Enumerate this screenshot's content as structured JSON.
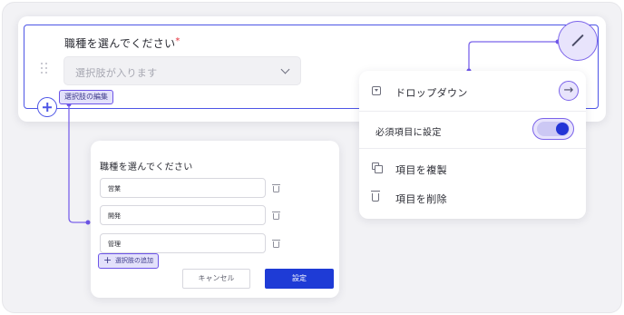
{
  "question": {
    "title": "職種を選んでください",
    "required_mark": "*",
    "select_placeholder": "選択肢が入ります"
  },
  "tags": {
    "edit_options": "選択肢の編集",
    "add_option": "選択肢の追加"
  },
  "menu": {
    "dropdown_label": "ドロップダウン",
    "arrow_glyph": "→",
    "required_label": "必須項目に設定",
    "required_on": true,
    "duplicate_label": "項目を複製",
    "delete_label": "項目を削除"
  },
  "dialog": {
    "title": "職種を選んでください",
    "options": [
      "営業",
      "開発",
      "管理"
    ],
    "cancel_label": "キャンセル",
    "ok_label": "設定"
  },
  "colors": {
    "accent": "#4d55e6",
    "highlight": "#7b63ea",
    "primary_button": "#1e3bd6",
    "required": "#e5333f"
  },
  "icons": [
    "drag-handle-icon",
    "chevron-down-icon",
    "plus-icon",
    "pencil-icon",
    "dropdown-icon",
    "arrow-right-icon",
    "copy-icon",
    "trash-icon"
  ]
}
